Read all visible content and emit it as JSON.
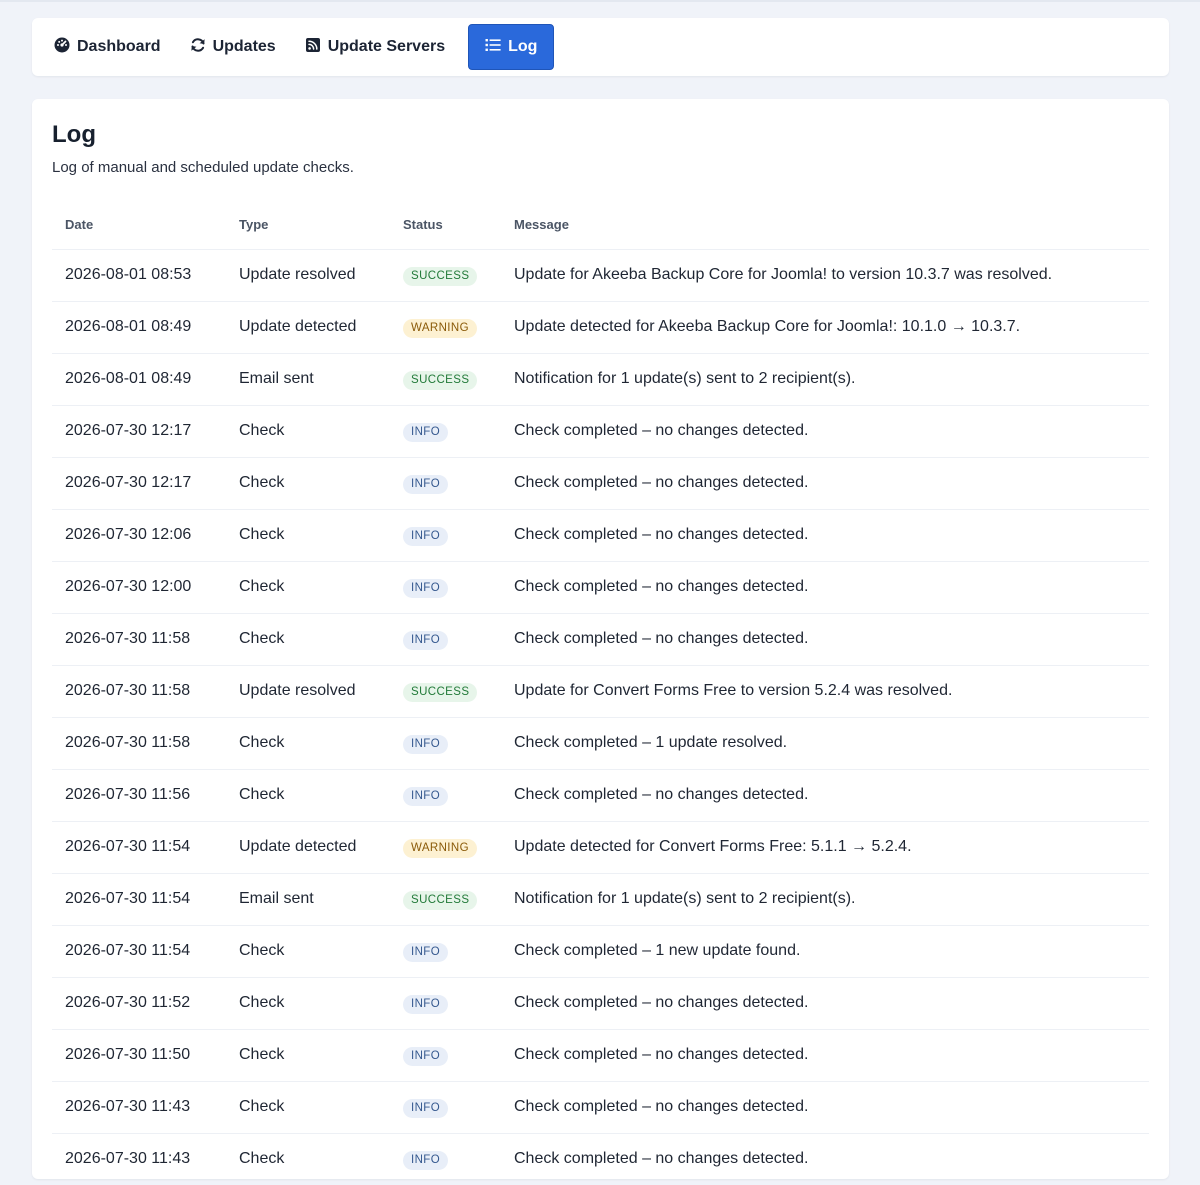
{
  "nav": {
    "items": [
      {
        "label": "Dashboard",
        "icon": "gauge-icon",
        "active": false
      },
      {
        "label": "Updates",
        "icon": "refresh-icon",
        "active": false
      },
      {
        "label": "Update Servers",
        "icon": "rss-icon",
        "active": false
      },
      {
        "label": "Log",
        "icon": "list-icon",
        "active": true
      }
    ]
  },
  "page": {
    "title": "Log",
    "description": "Log of manual and scheduled update checks."
  },
  "table": {
    "headers": {
      "date": "Date",
      "type": "Type",
      "status": "Status",
      "message": "Message"
    },
    "rows": [
      {
        "date": "2026-08-01 08:53",
        "type": "Update resolved",
        "status": "SUCCESS",
        "message": "Update for Akeeba Backup Core for Joomla! to version 10.3.7 was resolved."
      },
      {
        "date": "2026-08-01 08:49",
        "type": "Update detected",
        "status": "WARNING",
        "message": "Update detected for Akeeba Backup Core for Joomla!: 10.1.0 → 10.3.7."
      },
      {
        "date": "2026-08-01 08:49",
        "type": "Email sent",
        "status": "SUCCESS",
        "message": "Notification for 1 update(s) sent to 2 recipient(s)."
      },
      {
        "date": "2026-07-30 12:17",
        "type": "Check",
        "status": "INFO",
        "message": "Check completed – no changes detected."
      },
      {
        "date": "2026-07-30 12:17",
        "type": "Check",
        "status": "INFO",
        "message": "Check completed – no changes detected."
      },
      {
        "date": "2026-07-30 12:06",
        "type": "Check",
        "status": "INFO",
        "message": "Check completed – no changes detected."
      },
      {
        "date": "2026-07-30 12:00",
        "type": "Check",
        "status": "INFO",
        "message": "Check completed – no changes detected."
      },
      {
        "date": "2026-07-30 11:58",
        "type": "Check",
        "status": "INFO",
        "message": "Check completed – no changes detected."
      },
      {
        "date": "2026-07-30 11:58",
        "type": "Update resolved",
        "status": "SUCCESS",
        "message": "Update for Convert Forms Free to version 5.2.4 was resolved."
      },
      {
        "date": "2026-07-30 11:58",
        "type": "Check",
        "status": "INFO",
        "message": "Check completed – 1 update resolved."
      },
      {
        "date": "2026-07-30 11:56",
        "type": "Check",
        "status": "INFO",
        "message": "Check completed – no changes detected."
      },
      {
        "date": "2026-07-30 11:54",
        "type": "Update detected",
        "status": "WARNING",
        "message": "Update detected for Convert Forms Free: 5.1.1 → 5.2.4."
      },
      {
        "date": "2026-07-30 11:54",
        "type": "Email sent",
        "status": "SUCCESS",
        "message": "Notification for 1 update(s) sent to 2 recipient(s)."
      },
      {
        "date": "2026-07-30 11:54",
        "type": "Check",
        "status": "INFO",
        "message": "Check completed – 1 new update found."
      },
      {
        "date": "2026-07-30 11:52",
        "type": "Check",
        "status": "INFO",
        "message": "Check completed – no changes detected."
      },
      {
        "date": "2026-07-30 11:50",
        "type": "Check",
        "status": "INFO",
        "message": "Check completed – no changes detected."
      },
      {
        "date": "2026-07-30 11:43",
        "type": "Check",
        "status": "INFO",
        "message": "Check completed – no changes detected."
      },
      {
        "date": "2026-07-30 11:43",
        "type": "Check",
        "status": "INFO",
        "message": "Check completed – no changes detected."
      }
    ]
  },
  "colors": {
    "accent": "#2a69db",
    "success_bg": "#e7f5ea",
    "success_fg": "#227a39",
    "warning_bg": "#fdf1d2",
    "warning_fg": "#8a5a09",
    "info_bg": "#e8eef8",
    "info_fg": "#36598f"
  }
}
